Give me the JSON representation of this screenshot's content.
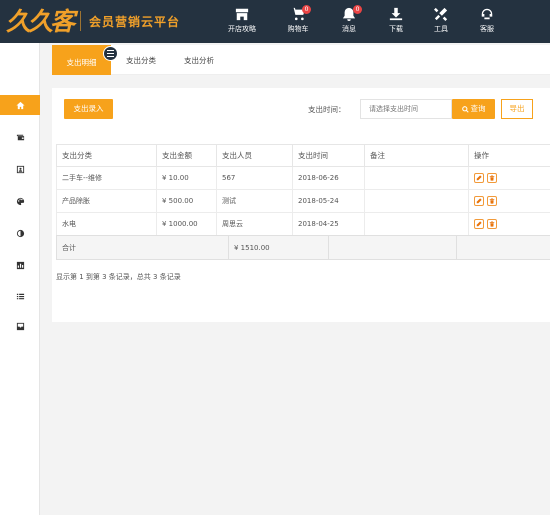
{
  "header": {
    "logo_text": "久久客",
    "platform_title": "会员营销云平台",
    "nav": [
      {
        "label": "开店攻略",
        "icon": "shop-icon"
      },
      {
        "label": "购物车",
        "icon": "cart-icon",
        "badge": "0"
      },
      {
        "label": "消息",
        "icon": "bell-icon",
        "badge": "0"
      },
      {
        "label": "下载",
        "icon": "download-icon"
      },
      {
        "label": "工具",
        "icon": "tools-icon"
      },
      {
        "label": "客服",
        "icon": "service-icon"
      }
    ]
  },
  "sidebar": {
    "items": [
      {
        "icon": "home-icon",
        "active": true
      },
      {
        "icon": "wallet-icon"
      },
      {
        "icon": "contact-card-icon"
      },
      {
        "icon": "palette-icon"
      },
      {
        "icon": "contrast-icon"
      },
      {
        "icon": "chart-icon"
      },
      {
        "icon": "list-icon"
      },
      {
        "icon": "inbox-icon"
      }
    ]
  },
  "tabs": [
    {
      "label": "支出明细",
      "active": true
    },
    {
      "label": "支出分类"
    },
    {
      "label": "支出分析"
    }
  ],
  "toolbar": {
    "add_label": "支出录入",
    "time_label": "支出时间：",
    "time_placeholder": "请选择支出时间",
    "search_label": "查询",
    "export_label": "导出"
  },
  "table": {
    "headers": [
      "支出分类",
      "支出金额",
      "支出人员",
      "支出时间",
      "备注",
      "操作"
    ],
    "rows": [
      {
        "category": "二手车--维修",
        "amount": "¥ 10.00",
        "person": "567",
        "date": "2018-06-26",
        "note": ""
      },
      {
        "category": "产品除胀",
        "amount": "¥ 500.00",
        "person": "测试",
        "date": "2018-05-24",
        "note": ""
      },
      {
        "category": "水电",
        "amount": "¥ 1000.00",
        "person": "周思云",
        "date": "2018-04-25",
        "note": ""
      }
    ],
    "total_label": "合计",
    "total_amount": "¥ 1510.00"
  },
  "pagination": {
    "summary": "显示第 1 到第 3 条记录，总共 3 条记录"
  },
  "colors": {
    "accent": "#f7a21b",
    "header_bg": "#243240",
    "badge": "#e94444"
  }
}
